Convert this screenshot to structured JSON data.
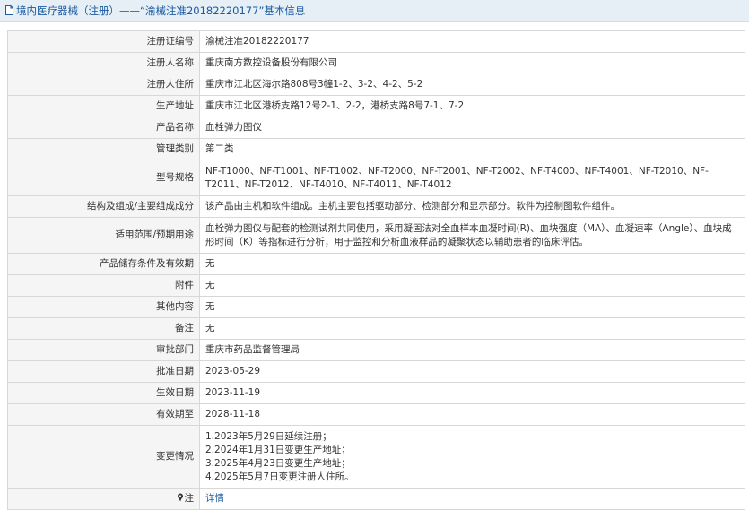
{
  "header": {
    "title": "境内医疗器械（注册）——“渝械注准20182220177”基本信息"
  },
  "rows": [
    {
      "label": "注册证编号",
      "value": "渝械注准20182220177"
    },
    {
      "label": "注册人名称",
      "value": "重庆南方数控设备股份有限公司"
    },
    {
      "label": "注册人住所",
      "value": "重庆市江北区海尔路808号3幢1-2、3-2、4-2、5-2"
    },
    {
      "label": "生产地址",
      "value": "重庆市江北区港桥支路12号2-1、2-2，港桥支路8号7-1、7-2"
    },
    {
      "label": "产品名称",
      "value": "血栓弹力图仪"
    },
    {
      "label": "管理类别",
      "value": "第二类"
    },
    {
      "label": "型号规格",
      "value": "NF-T1000、NF-T1001、NF-T1002、NF-T2000、NF-T2001、NF-T2002、NF-T4000、NF-T4001、NF-T2010、NF-T2011、NF-T2012、NF-T4010、NF-T4011、NF-T4012"
    },
    {
      "label": "结构及组成/主要组成成分",
      "value": "该产品由主机和软件组成。主机主要包括驱动部分、检测部分和显示部分。软件为控制图软件组件。"
    },
    {
      "label": "适用范围/预期用途",
      "value": "血栓弹力图仪与配套的检测试剂共同使用，采用凝固法对全血样本血凝时间(R)、血块强度（MA）、血凝速率（Angle）、血块成形时间（K）等指标进行分析，用于监控和分析血液样品的凝聚状态以辅助患者的临床评估。"
    },
    {
      "label": "产品储存条件及有效期",
      "value": "无"
    },
    {
      "label": "附件",
      "value": "无"
    },
    {
      "label": "其他内容",
      "value": "无"
    },
    {
      "label": "备注",
      "value": "无"
    },
    {
      "label": "审批部门",
      "value": "重庆市药品监督管理局"
    },
    {
      "label": "批准日期",
      "value": "2023-05-29"
    },
    {
      "label": "生效日期",
      "value": "2023-11-19"
    },
    {
      "label": "有效期至",
      "value": "2028-11-18"
    }
  ],
  "changes": {
    "label": "变更情况",
    "lines": [
      "1.2023年5月29日延续注册；",
      "2.2024年1月31日变更生产地址；",
      "3.2025年4月23日变更生产地址；",
      "4.2025年5月7日变更注册人住所。"
    ]
  },
  "note": {
    "label": "注",
    "link_text": "详情"
  },
  "icons": {
    "header": "document-icon",
    "note": "pin-icon"
  },
  "colors": {
    "header_bg": "#e6eef6",
    "header_text": "#1a5aa0",
    "label_bg": "#f5f5f5",
    "border": "#d8d8d8",
    "link": "#1a5aa0"
  }
}
